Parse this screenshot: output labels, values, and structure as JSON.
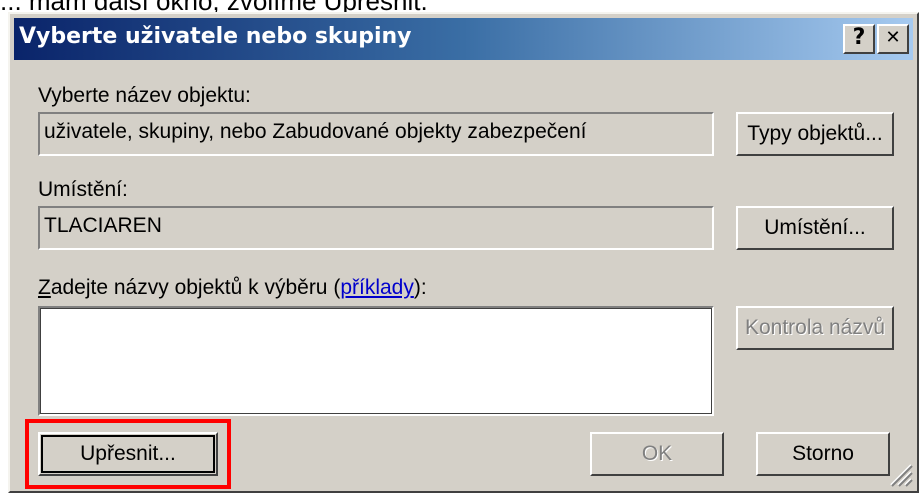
{
  "caption": "... mám další okno, zvolíme Upřesnit.",
  "dialog": {
    "title": "Vyberte uživatele nebo skupiny",
    "help_glyph": "?",
    "close_glyph": "✕"
  },
  "object_type": {
    "label": "Vyberte název objektu:",
    "value": "uživatele, skupiny, nebo Zabudované objekty zabezpečení",
    "button": "Typy objektů..."
  },
  "location": {
    "label": "Umístění:",
    "value": "TLACIAREN",
    "button": "Umístění..."
  },
  "names": {
    "label_accel": "Z",
    "label_rest": "adejte názvy objektů k výběru (",
    "examples_link": "příklady",
    "label_end": "):",
    "value": "",
    "check_button": "Kontrola názvů"
  },
  "footer": {
    "advanced_button": "Upřesnit...",
    "ok_button": "OK",
    "cancel_button": "Storno"
  },
  "colors": {
    "highlight": "#ff0000",
    "title_gradient_start": "#0a246a",
    "title_gradient_end": "#a6caf0",
    "dialog_face": "#d4d0c8",
    "link": "#0000cc"
  }
}
